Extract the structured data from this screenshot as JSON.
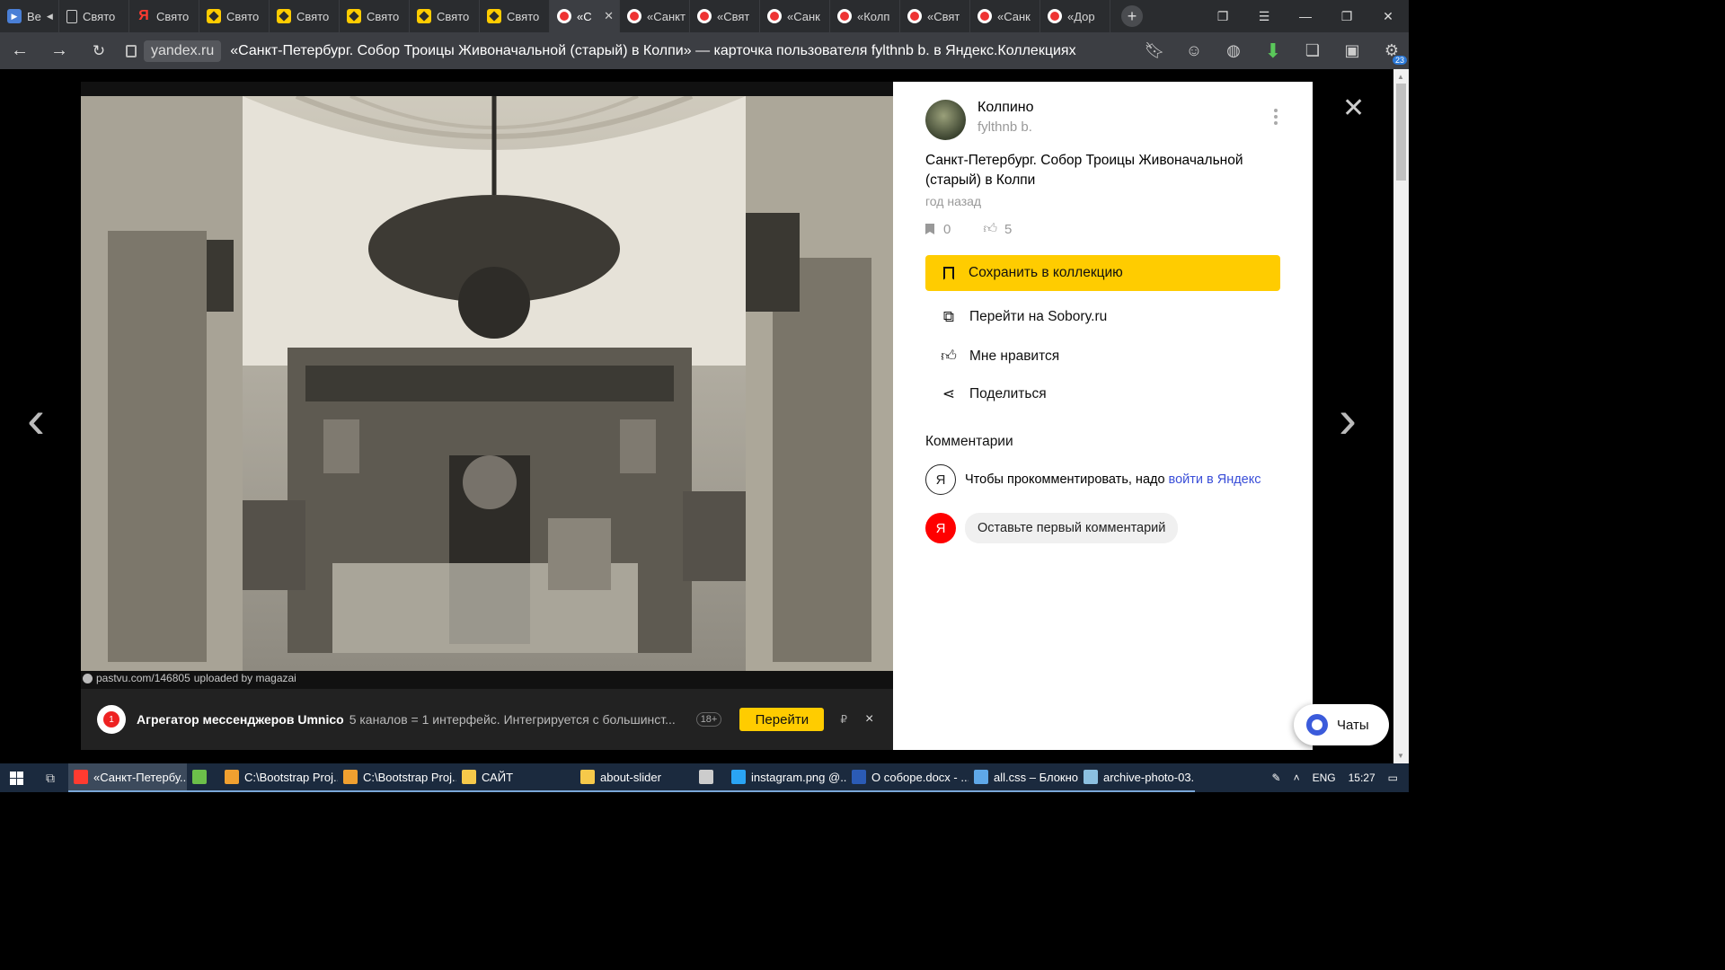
{
  "tabs": [
    {
      "label": "Ве",
      "icon": "play-icon",
      "kind": "play"
    },
    {
      "label": "Свято",
      "icon": "document-icon",
      "kind": "doc"
    },
    {
      "label": "Свято",
      "icon": "yandex-icon",
      "kind": "ya"
    },
    {
      "label": "Свято",
      "icon": "collections-icon",
      "kind": "coll"
    },
    {
      "label": "Свято",
      "icon": "collections-icon",
      "kind": "coll"
    },
    {
      "label": "Свято",
      "icon": "collections-icon",
      "kind": "coll"
    },
    {
      "label": "Свято",
      "icon": "collections-icon",
      "kind": "coll"
    },
    {
      "label": "Свято",
      "icon": "collections-icon",
      "kind": "coll"
    },
    {
      "label": "«С",
      "icon": "collections-red-icon",
      "kind": "red",
      "active": true
    },
    {
      "label": "«Санкт",
      "icon": "collections-red-icon",
      "kind": "red"
    },
    {
      "label": "«Свят",
      "icon": "collections-red-icon",
      "kind": "red"
    },
    {
      "label": "«Санк",
      "icon": "collections-red-icon",
      "kind": "red"
    },
    {
      "label": "«Колп",
      "icon": "collections-red-icon",
      "kind": "red"
    },
    {
      "label": "«Свят",
      "icon": "collections-red-icon",
      "kind": "red"
    },
    {
      "label": "«Санк",
      "icon": "collections-red-icon",
      "kind": "red"
    },
    {
      "label": "«Дор",
      "icon": "collections-red-icon",
      "kind": "red"
    }
  ],
  "address": {
    "domain": "yandex.ru",
    "title": "«Санкт-Петербург. Собор Троицы Живоначальной (старый) в Колпи» — карточка пользователя fylthnb b. в Яндекс.Коллекциях",
    "extension_badge": "23"
  },
  "photo": {
    "source": "pastvu.com/146805",
    "uploaded": "uploaded by magazai"
  },
  "ad": {
    "icon_text": "1",
    "title": "Агрегатор мессенджеров Umnico",
    "text": "5 каналов = 1 интерфейс. Интегрируется с большинст...",
    "age": "18+",
    "go": "Перейти",
    "currency": "₽",
    "close": "×"
  },
  "card": {
    "owner": "Колпино",
    "user": "fylthnb b.",
    "title": "Санкт-Петербург. Собор Троицы Живоначальной (старый) в Колпи",
    "time": "год назад",
    "bookmarks": "0",
    "likes": "5",
    "save_button": "Сохранить в коллекцию",
    "actions": [
      {
        "label": "Перейти на Sobory.ru",
        "icon": "external-link-icon"
      },
      {
        "label": "Мне нравится",
        "icon": "thumbs-up-icon"
      },
      {
        "label": "Поделиться",
        "icon": "share-icon"
      }
    ],
    "comments_heading": "Комментарии",
    "comment_prompt": "Чтобы прокомментировать, надо",
    "login_link": "войти в Яндекс",
    "first_comment": "Оставьте первый комментарий",
    "ya_letter": "Я"
  },
  "chats_label": "Чаты",
  "taskbar": {
    "items": [
      {
        "label": "«Санкт-Петербу...",
        "active": true,
        "color": "#ff3b30"
      },
      {
        "label": "",
        "color": "#6cbf4a"
      },
      {
        "label": "C:\\Bootstrap Proj...",
        "color": "#f0a030"
      },
      {
        "label": "C:\\Bootstrap Proj...",
        "color": "#f0a030"
      },
      {
        "label": "САЙТ",
        "color": "#f6c94a"
      },
      {
        "label": "about-slider",
        "color": "#f6c94a"
      },
      {
        "label": "",
        "color": "#cccccc"
      },
      {
        "label": "instagram.png @...",
        "color": "#2aa4f4"
      },
      {
        "label": "О соборе.docx - ...",
        "color": "#2b5bb5"
      },
      {
        "label": "all.css – Блокнот",
        "color": "#5fa8e8"
      },
      {
        "label": "archive-photo-03...",
        "color": "#8cc0e0"
      }
    ],
    "lang": "ENG",
    "time": "15:27"
  }
}
